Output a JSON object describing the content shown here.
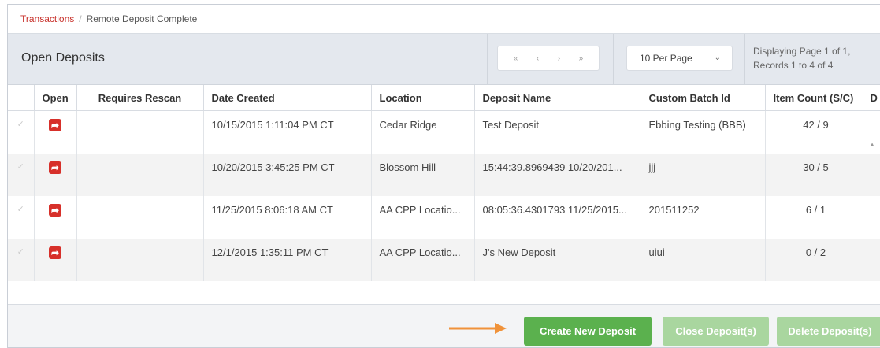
{
  "breadcrumb": {
    "link": "Transactions",
    "separator": "/",
    "current": "Remote Deposit Complete"
  },
  "header": {
    "title": "Open Deposits",
    "pager": {
      "first": "«",
      "prev": "‹",
      "next": "›",
      "last": "»"
    },
    "per_page": "10 Per Page",
    "page_info_line1": "Displaying Page 1 of 1,",
    "page_info_line2": "Records 1 to 4 of 4"
  },
  "table": {
    "columns": [
      "Open",
      "Requires Rescan",
      "Date Created",
      "Location",
      "Deposit Name",
      "Custom Batch Id",
      "Item Count (S/C)",
      "D"
    ],
    "rows": [
      {
        "date": "10/15/2015 1:11:04 PM CT",
        "location": "Cedar Ridge",
        "deposit": "Test Deposit",
        "batch": "Ebbing Testing (BBB)",
        "count": "42 / 9"
      },
      {
        "date": "10/20/2015 3:45:25 PM CT",
        "location": "Blossom Hill",
        "deposit": "15:44:39.8969439 10/20/201...",
        "batch": "jjj",
        "count": "30 / 5"
      },
      {
        "date": "11/25/2015 8:06:18 AM CT",
        "location": "AA CPP Locatio...",
        "deposit": "08:05:36.4301793 11/25/2015...",
        "batch": "201511252",
        "count": "6 / 1"
      },
      {
        "date": "12/1/2015 1:35:11 PM CT",
        "location": "AA CPP Locatio...",
        "deposit": "J's New Deposit",
        "batch": "uiui",
        "count": "0 / 2"
      }
    ]
  },
  "footer": {
    "create": "Create New Deposit",
    "close": "Close Deposit(s)",
    "delete": "Delete Deposit(s)"
  },
  "icons": {
    "open": "open-arrow-icon",
    "check": "checkmark-icon",
    "pointer": "arrow-pointer-icon"
  },
  "colors": {
    "accent_red": "#d7302a",
    "button_green": "#5bb14e",
    "button_green_disabled": "#a9d69f",
    "arrow_orange": "#f0923a"
  }
}
